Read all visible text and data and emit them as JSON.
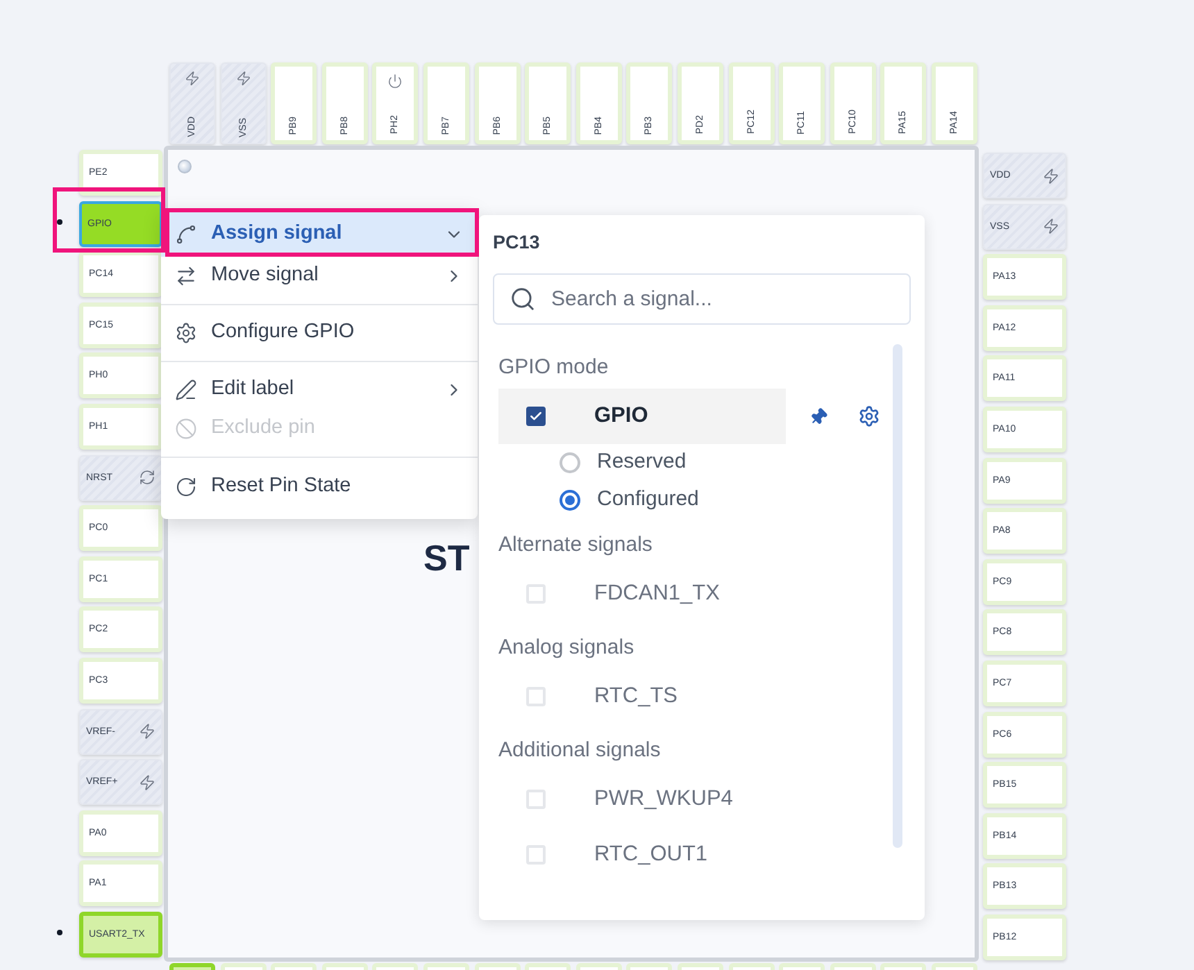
{
  "top_pins": [
    {
      "label": "VDD",
      "kind": "power"
    },
    {
      "label": "VSS",
      "kind": "power"
    },
    {
      "label": "PB9",
      "kind": "io"
    },
    {
      "label": "PB8",
      "kind": "io"
    },
    {
      "label": "PH2",
      "kind": "boot"
    },
    {
      "label": "PB7",
      "kind": "io"
    },
    {
      "label": "PB6",
      "kind": "io"
    },
    {
      "label": "PB5",
      "kind": "io"
    },
    {
      "label": "PB4",
      "kind": "io"
    },
    {
      "label": "PB3",
      "kind": "io"
    },
    {
      "label": "PD2",
      "kind": "io"
    },
    {
      "label": "PC12",
      "kind": "io"
    },
    {
      "label": "PC11",
      "kind": "io"
    },
    {
      "label": "PC10",
      "kind": "io"
    },
    {
      "label": "PA15",
      "kind": "io"
    },
    {
      "label": "PA14",
      "kind": "io"
    }
  ],
  "left_pins": [
    {
      "label": "PE2",
      "kind": "io",
      "marker": false
    },
    {
      "label": "GPIO",
      "kind": "selected",
      "marker": true
    },
    {
      "label": "PC14",
      "kind": "io",
      "marker": false
    },
    {
      "label": "PC15",
      "kind": "io",
      "marker": false
    },
    {
      "label": "PH0",
      "kind": "io",
      "marker": false
    },
    {
      "label": "PH1",
      "kind": "io",
      "marker": false
    },
    {
      "label": "NRST",
      "kind": "reset",
      "marker": false
    },
    {
      "label": "PC0",
      "kind": "io",
      "marker": false
    },
    {
      "label": "PC1",
      "kind": "io",
      "marker": false
    },
    {
      "label": "PC2",
      "kind": "io",
      "marker": false
    },
    {
      "label": "PC3",
      "kind": "io",
      "marker": false
    },
    {
      "label": "VREF-",
      "kind": "power",
      "marker": false
    },
    {
      "label": "VREF+",
      "kind": "power",
      "marker": false
    },
    {
      "label": "PA0",
      "kind": "io",
      "marker": false
    },
    {
      "label": "PA1",
      "kind": "io",
      "marker": false
    },
    {
      "label": "USART2_TX",
      "kind": "assigned",
      "marker": true
    }
  ],
  "right_pins": [
    {
      "label": "VDD",
      "kind": "power"
    },
    {
      "label": "VSS",
      "kind": "power"
    },
    {
      "label": "PA13",
      "kind": "io"
    },
    {
      "label": "PA12",
      "kind": "io"
    },
    {
      "label": "PA11",
      "kind": "io"
    },
    {
      "label": "PA10",
      "kind": "io"
    },
    {
      "label": "PA9",
      "kind": "io"
    },
    {
      "label": "PA8",
      "kind": "io"
    },
    {
      "label": "PC9",
      "kind": "io"
    },
    {
      "label": "PC8",
      "kind": "io"
    },
    {
      "label": "PC7",
      "kind": "io"
    },
    {
      "label": "PC6",
      "kind": "io"
    },
    {
      "label": "PB15",
      "kind": "io"
    },
    {
      "label": "PB14",
      "kind": "io"
    },
    {
      "label": "PB13",
      "kind": "io"
    },
    {
      "label": "PB12",
      "kind": "io"
    }
  ],
  "bottom_pins": [
    {
      "kind": "assigned"
    },
    {
      "kind": "io"
    },
    {
      "kind": "io"
    },
    {
      "kind": "io"
    },
    {
      "kind": "io"
    },
    {
      "kind": "io"
    },
    {
      "kind": "io"
    },
    {
      "kind": "io"
    },
    {
      "kind": "io"
    },
    {
      "kind": "io"
    },
    {
      "kind": "io"
    },
    {
      "kind": "io"
    },
    {
      "kind": "io"
    },
    {
      "kind": "io"
    },
    {
      "kind": "io"
    },
    {
      "kind": "io"
    }
  ],
  "chip": {
    "title": "ST"
  },
  "context_menu": {
    "groups": [
      {
        "items": [
          {
            "label": "Assign signal",
            "highlighted": true,
            "disabled": false,
            "has_submenu": true,
            "expanded": true
          },
          {
            "label": "Move signal",
            "highlighted": false,
            "disabled": false,
            "has_submenu": true,
            "expanded": false
          }
        ]
      },
      {
        "items": [
          {
            "label": "Configure GPIO",
            "highlighted": false,
            "disabled": false,
            "has_submenu": false
          }
        ]
      },
      {
        "items": [
          {
            "label": "Edit label",
            "highlighted": false,
            "disabled": false,
            "has_submenu": true,
            "expanded": false
          },
          {
            "label": "Exclude pin",
            "highlighted": false,
            "disabled": true,
            "has_submenu": false
          }
        ]
      },
      {
        "items": [
          {
            "label": "Reset Pin State",
            "highlighted": false,
            "disabled": false,
            "has_submenu": false
          }
        ]
      }
    ]
  },
  "signal_panel": {
    "title": "PC13",
    "search": {
      "placeholder": "Search a signal..."
    },
    "sections": [
      {
        "title": "GPIO mode",
        "signals": [
          {
            "label": "GPIO",
            "checked": true,
            "highlighted": true,
            "options": [
              {
                "label": "Reserved",
                "selected": false
              },
              {
                "label": "Configured",
                "selected": true
              }
            ]
          }
        ]
      },
      {
        "title": "Alternate signals",
        "signals": [
          {
            "label": "FDCAN1_TX",
            "checked": false,
            "highlighted": false
          }
        ]
      },
      {
        "title": "Analog signals",
        "signals": [
          {
            "label": "RTC_TS",
            "checked": false,
            "highlighted": false
          }
        ]
      },
      {
        "title": "Additional signals",
        "signals": [
          {
            "label": "PWR_WKUP4",
            "checked": false,
            "highlighted": false
          },
          {
            "label": "RTC_OUT1",
            "checked": false,
            "highlighted": false
          }
        ]
      }
    ]
  }
}
